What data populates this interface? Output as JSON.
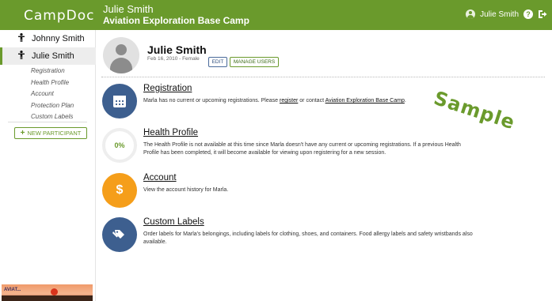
{
  "header": {
    "logo": "CampDoc",
    "participant_name": "Julie Smith",
    "camp_name": "Aviation Exploration Base Camp",
    "user_name": "Julie Smith",
    "help_icon_char": "?"
  },
  "sidebar": {
    "participants": [
      {
        "name": "Johnny Smith"
      },
      {
        "name": "Julie Smith"
      }
    ],
    "links": [
      "Registration",
      "Health Profile",
      "Account",
      "Protection Plan",
      "Custom Labels"
    ],
    "new_participant": "NEW PARTICIPANT",
    "camp_logo_text": "AVIAT..."
  },
  "profile": {
    "name": "Julie Smith",
    "meta": "Feb 16, 2010 - Female",
    "edit_label": "EDIT",
    "manage_label": "MANAGE USERS"
  },
  "watermark": "Sample",
  "sections": {
    "registration": {
      "title": "Registration",
      "desc_pre": "Marla has no current or upcoming registrations. Please ",
      "link1": "register",
      "desc_mid": " or contact ",
      "link2": "Aviation Exploration Base Camp",
      "desc_post": "."
    },
    "health": {
      "title": "Health Profile",
      "progress": "0%",
      "desc": "The Health Profile is not available at this time since Marla doesn't have any current or upcoming registrations. If a previous Health Profile has been completed, it will become available for viewing upon registering for a new session."
    },
    "account": {
      "title": "Account",
      "icon_char": "$",
      "desc": "View the account history for Marla."
    },
    "labels": {
      "title": "Custom Labels",
      "desc": "Order labels for Marla's belongings, including labels for clothing, shoes, and containers. Food allergy labels and safety wristbands also available."
    }
  },
  "colors": {
    "brand_green": "#6a9a2c",
    "icon_blue": "#3d5f8f",
    "icon_orange": "#f59e1a"
  }
}
